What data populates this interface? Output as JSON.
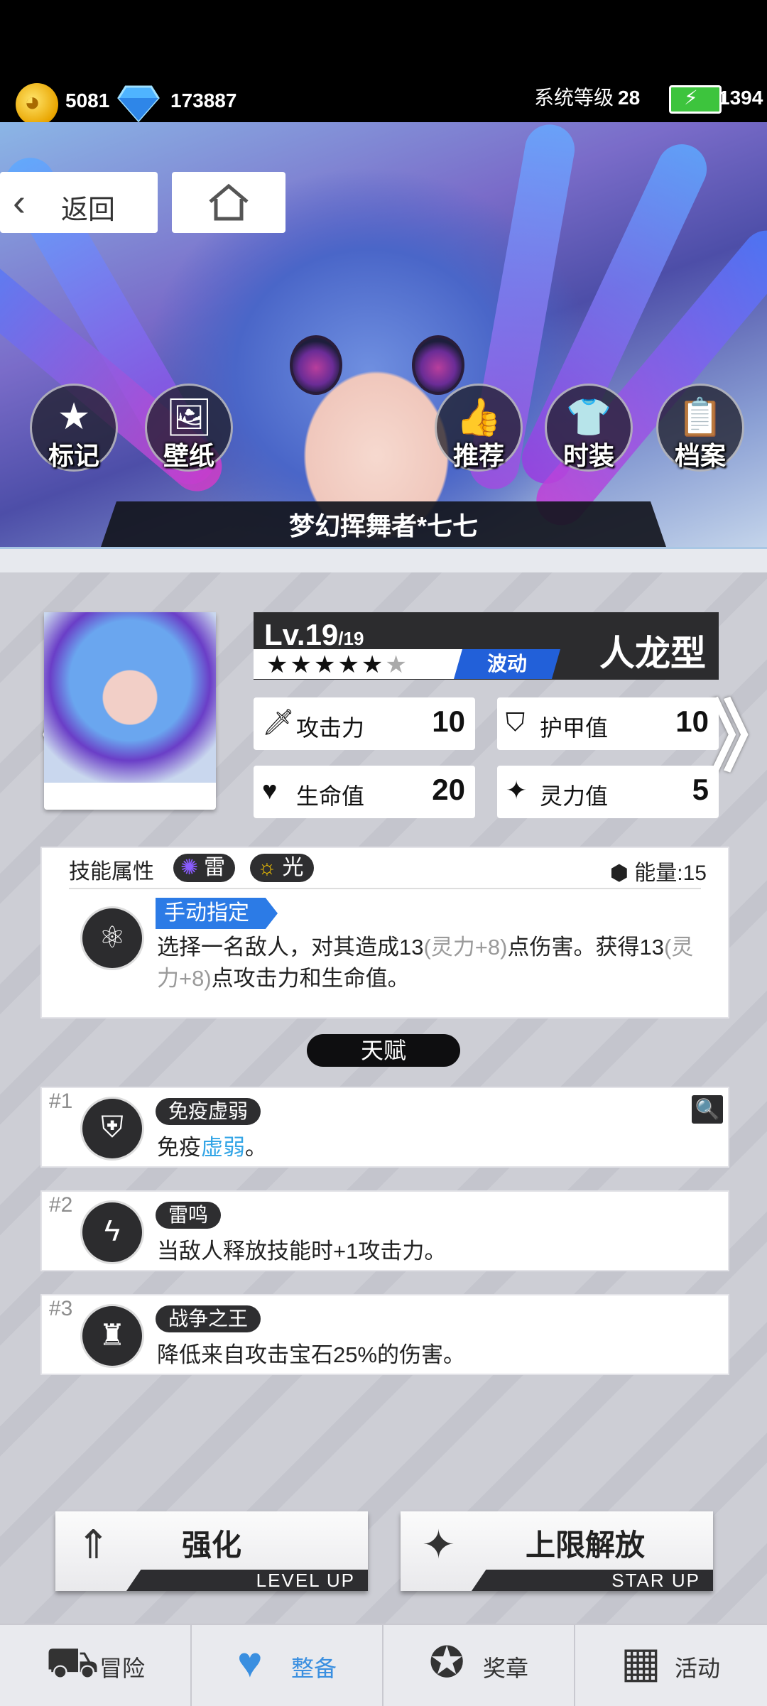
{
  "status": {
    "coins": "5081",
    "gems": "173887",
    "system_level_label": "系统等级",
    "system_level": "28",
    "energy": "1394"
  },
  "nav": {
    "back_label": "返回"
  },
  "banner": {
    "buttons": [
      {
        "label": "标记",
        "icon": "star-icon"
      },
      {
        "label": "壁纸",
        "icon": "image-icon"
      },
      {
        "label": "推荐",
        "icon": "thumbs-up-icon"
      },
      {
        "label": "时装",
        "icon": "shirt-icon"
      },
      {
        "label": "档案",
        "icon": "document-icon"
      }
    ],
    "character_name": "梦幻挥舞者*七七"
  },
  "character": {
    "level": "Lv.19",
    "level_max": "/19",
    "stars": "★★★★★",
    "star_empty": "★",
    "wave_tag": "波动",
    "type": "人龙型",
    "stats": [
      {
        "label": "攻击力",
        "value": "10",
        "icon": "sword-icon"
      },
      {
        "label": "护甲值",
        "value": "10",
        "icon": "shield-icon"
      },
      {
        "label": "生命值",
        "value": "20",
        "icon": "heart-icon"
      },
      {
        "label": "灵力值",
        "value": "5",
        "icon": "sparkle-icon"
      }
    ]
  },
  "skill": {
    "attr_label": "技能属性",
    "elements": [
      {
        "name": "雷",
        "icon": "thunder-icon"
      },
      {
        "name": "光",
        "icon": "sun-icon"
      }
    ],
    "energy_label": "能量:15",
    "tag": "手动指定",
    "desc_1": "选择一名敌人，对其造成13",
    "desc_2": "(灵力+8)",
    "desc_3": "点伤害。获得13",
    "desc_4": "(灵力+8)",
    "desc_5": "点攻击力和生命值。"
  },
  "talent_header": "天赋",
  "talents": [
    {
      "num": "#1",
      "name": "免疫虚弱",
      "desc_prefix": "免疫",
      "desc_link": "虚弱",
      "desc_suffix": "。"
    },
    {
      "num": "#2",
      "name": "雷鸣",
      "desc": "当敌人释放技能时+1攻击力。"
    },
    {
      "num": "#3",
      "name": "战争之王",
      "desc": "降低来自攻击宝石25%的伤害。"
    }
  ],
  "actions": {
    "enhance_label": "强化",
    "enhance_sub": "LEVEL UP",
    "unlock_label": "上限解放",
    "unlock_sub": "STAR UP"
  },
  "bottom_nav": [
    {
      "label": "冒险",
      "icon": "truck-icon"
    },
    {
      "label": "整备",
      "icon": "heart-hands-icon",
      "active": true
    },
    {
      "label": "奖章",
      "icon": "medal-icon"
    },
    {
      "label": "活动",
      "icon": "calendar-icon"
    }
  ]
}
